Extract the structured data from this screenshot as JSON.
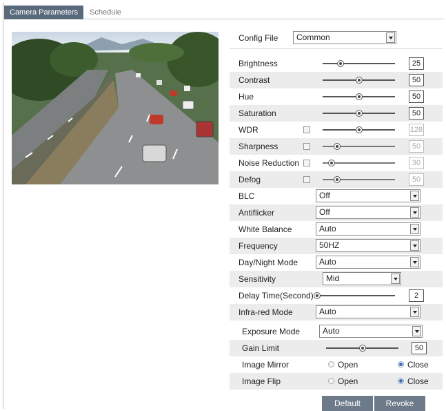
{
  "tabs": [
    "Camera Parameters",
    "Schedule"
  ],
  "config_file": {
    "label": "Config File",
    "value": "Common"
  },
  "sliders": {
    "brightness": {
      "label": "Brightness",
      "value": "25",
      "level": 0.25
    },
    "contrast": {
      "label": "Contrast",
      "value": "50",
      "level": 0.5
    },
    "hue": {
      "label": "Hue",
      "value": "50",
      "level": 0.5
    },
    "saturation": {
      "label": "Saturation",
      "value": "50",
      "level": 0.5
    },
    "wdr": {
      "label": "WDR",
      "value": "128",
      "level": 0.5,
      "enabled": false
    },
    "sharpness": {
      "label": "Sharpness",
      "value": "50",
      "level": 0.2,
      "enabled": false
    },
    "noise_reduction": {
      "label": "Noise Reduction",
      "value": "30",
      "level": 0.12,
      "enabled": false
    },
    "defog": {
      "label": "Defog",
      "value": "50",
      "level": 0.2,
      "enabled": false
    },
    "delay_time": {
      "label": "Delay Time(Second)",
      "value": "2",
      "level": 0.02
    },
    "gain_limit": {
      "label": "Gain Limit",
      "value": "50",
      "level": 0.5
    }
  },
  "selects": {
    "blc": {
      "label": "BLC",
      "value": "Off"
    },
    "antiflicker": {
      "label": "Antiflicker",
      "value": "Off"
    },
    "white_balance": {
      "label": "White Balance",
      "value": "Auto"
    },
    "frequency": {
      "label": "Frequency",
      "value": "50HZ"
    },
    "day_night_mode": {
      "label": "Day/Night Mode",
      "value": "Auto"
    },
    "sensitivity": {
      "label": "Sensitivity",
      "value": "Mid"
    },
    "infrared_mode": {
      "label": "Infra-red Mode",
      "value": "Auto"
    },
    "exposure_mode": {
      "label": "Exposure Mode",
      "value": "Auto"
    }
  },
  "image_mirror": {
    "label": "Image Mirror",
    "open": "Open",
    "close": "Close",
    "selected": "Close"
  },
  "image_flip": {
    "label": "Image Flip",
    "open": "Open",
    "close": "Close",
    "selected": "Close"
  },
  "buttons": {
    "default": "Default",
    "revoke": "Revoke"
  },
  "colors": {
    "tab_active": "#5a6a7d",
    "button": "#6d7a89",
    "row_shade": "#ececec"
  }
}
